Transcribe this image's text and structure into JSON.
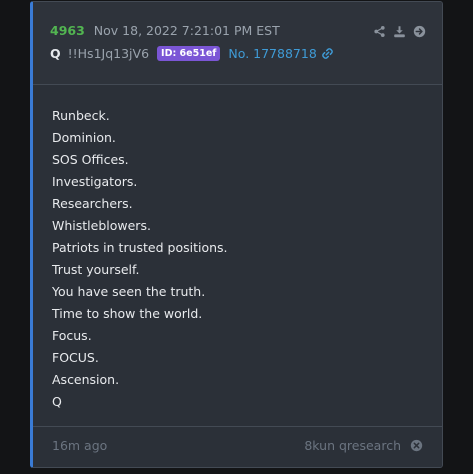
{
  "post": {
    "number": "4963",
    "timestamp": "Nov 18, 2022 7:21:01 PM EST",
    "author": "Q",
    "tripcode": "!!Hs1Jq13jV6",
    "id_label": "ID: 6e51ef",
    "post_no": "No. 17788718",
    "lines": [
      "Runbeck.",
      "Dominion.",
      "SOS Offices.",
      "Investigators.",
      "Researchers.",
      "Whistleblowers.",
      "Patriots in trusted positions.",
      "Trust yourself.",
      "You have seen the truth.",
      "Time to show the world.",
      "Focus.",
      "FOCUS.",
      "Ascension.",
      "Q"
    ]
  },
  "footer": {
    "relative_time": "16m ago",
    "source": "8kun qresearch"
  },
  "icons": {
    "share": "share-icon",
    "download": "download-icon",
    "goto": "arrow-right-circle-icon",
    "link": "link-icon",
    "close": "close-circle-icon"
  },
  "colors": {
    "background": "#131416",
    "card": "#2b3038",
    "accent_border": "#3a7bd5",
    "post_number": "#52b551",
    "id_badge": "#7b56d6",
    "link": "#3f9bd6"
  }
}
